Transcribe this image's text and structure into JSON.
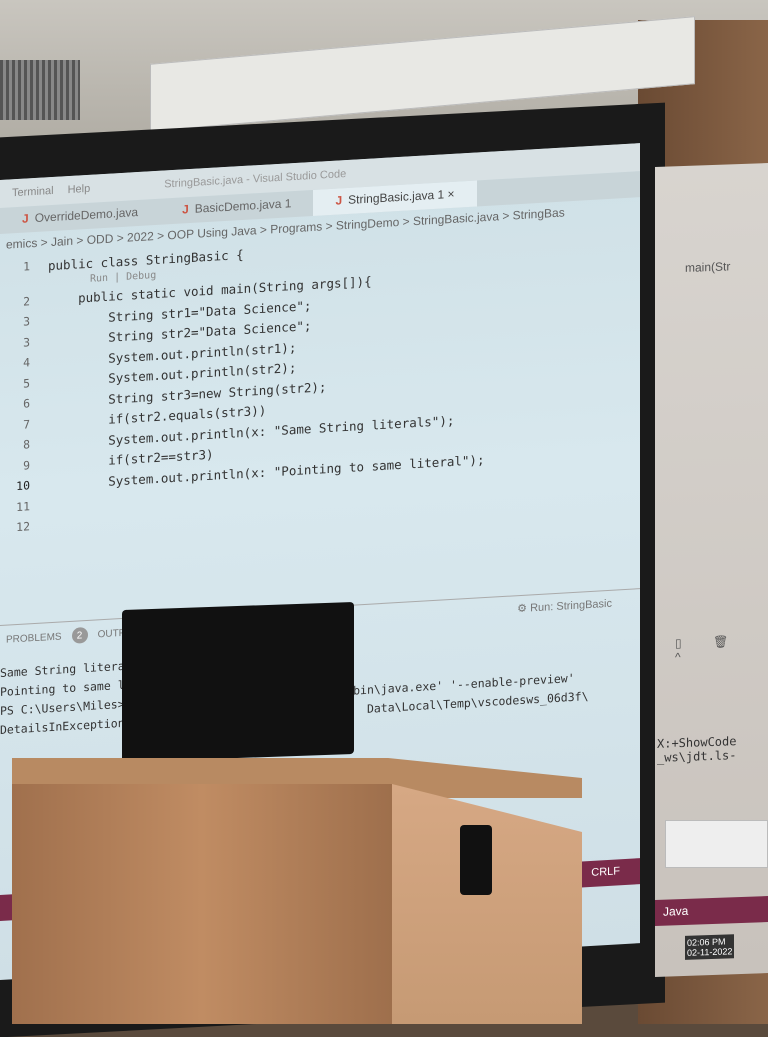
{
  "window_title": "StringBasic.java - Visual Studio Code",
  "menu": [
    "Terminal",
    "Help"
  ],
  "tabs": [
    {
      "label": "OverrideDemo.java"
    },
    {
      "label": "BasicDemo.java 1"
    },
    {
      "label": "StringBasic.java 1",
      "close": "×"
    }
  ],
  "breadcrumb": "emics > Jain > ODD > 2022 > OOP Using Java > Programs > StringDemo > StringBasic.java > StringBas",
  "codelens": "Run | Debug",
  "code": [
    {
      "n": "1",
      "t": "public class StringBasic {"
    },
    {
      "n": "2",
      "t": "    public static void main(String args[]){"
    },
    {
      "n": "3",
      "t": "        String str1=\"Data Science\";"
    },
    {
      "n": "3",
      "t": "        String str2=\"Data Science\";"
    },
    {
      "n": "4",
      "t": "        System.out.println(str1);"
    },
    {
      "n": "5",
      "t": "        System.out.println(str2);"
    },
    {
      "n": "6",
      "t": "        String str3=new String(str2);"
    },
    {
      "n": "7",
      "t": "        if(str2.equals(str3))"
    },
    {
      "n": "8",
      "t": "        System.out.println(x: \"Same String literals\");"
    },
    {
      "n": "9",
      "t": "        if(str2==str3)"
    },
    {
      "n": "10",
      "t": "        System.out.println(x: \"Pointing to same literal\");"
    },
    {
      "n": "11",
      "t": ""
    },
    {
      "n": "12",
      "t": ""
    }
  ],
  "panel": {
    "problems_label": "PROBLEMS",
    "problems_count": "2",
    "output_label": "OUTPU",
    "run_label": "Run: StringBasic"
  },
  "terminal": [
    "Same String literals",
    "Pointing to same lite",
    "PS C:\\Users\\Miles>  &                              bin\\java.exe' '--enable-preview'",
    "DetailsInExceptionMess                               Data\\Local\\Temp\\vscodesws_06d3f\\"
  ],
  "status": {
    "crlf": "CRLF",
    "lang": "Java"
  },
  "right_screen": {
    "text": "X:+ShowCode",
    "text2": "_ws\\jdt.ls-",
    "time": "02:06 PM",
    "date": "02-11-2022",
    "tab": "main(Str"
  }
}
